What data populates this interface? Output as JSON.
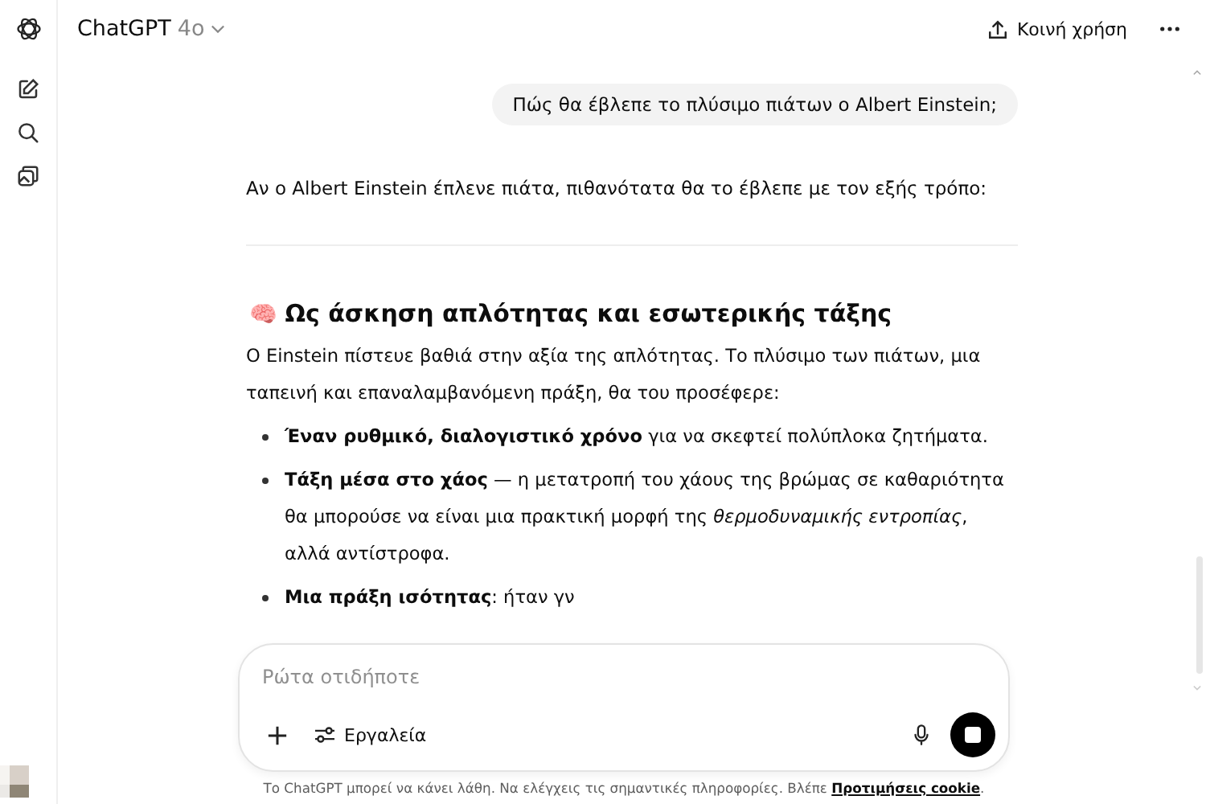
{
  "header": {
    "title": "ChatGPT",
    "model": "4o",
    "share": "Κοινή χρήση"
  },
  "user_message": "Πώς θα έβλεπε το πλύσιμο πιάτων ο Albert Einstein;",
  "intro": "Αν ο Albert Einstein έπλενε πιάτα, πιθανότατα θα το έβλεπε με τον εξής τρόπο:",
  "section": {
    "emoji": "🧠",
    "heading": "Ως άσκηση απλότητας και εσωτερικής τάξης",
    "paragraph": "Ο Einstein πίστευε βαθιά στην αξία της απλότητας. Το πλύσιμο των πιάτων, μια ταπεινή και επαναλαμβανόμενη πράξη, θα του προσέφερε:",
    "bullets": [
      "**Έναν ρυθμικό, διαλογιστικό χρόνο** για να σκεφτεί πολύπλοκα ζητήματα.",
      "**Τάξη μέσα στο χάος** — η μετατροπή του χάους της βρώμας σε καθαριότητα θα μπορούσε να είναι μια πρακτική μορφή της *θερμοδυναμικής εντροπίας*, αλλά αντίστροφα.",
      "**Μια πράξη ισότητας**: ήταν γν"
    ]
  },
  "composer": {
    "placeholder": "Ρώτα οτιδήποτε",
    "tools": "Εργαλεία"
  },
  "footer": {
    "text": "Το ChatGPT μπορεί να κάνει λάθη. Να ελέγχεις τις σημαντικές πληροφορίες. Βλέπε",
    "link": "Προτιμήσεις cookie",
    "end": "."
  }
}
